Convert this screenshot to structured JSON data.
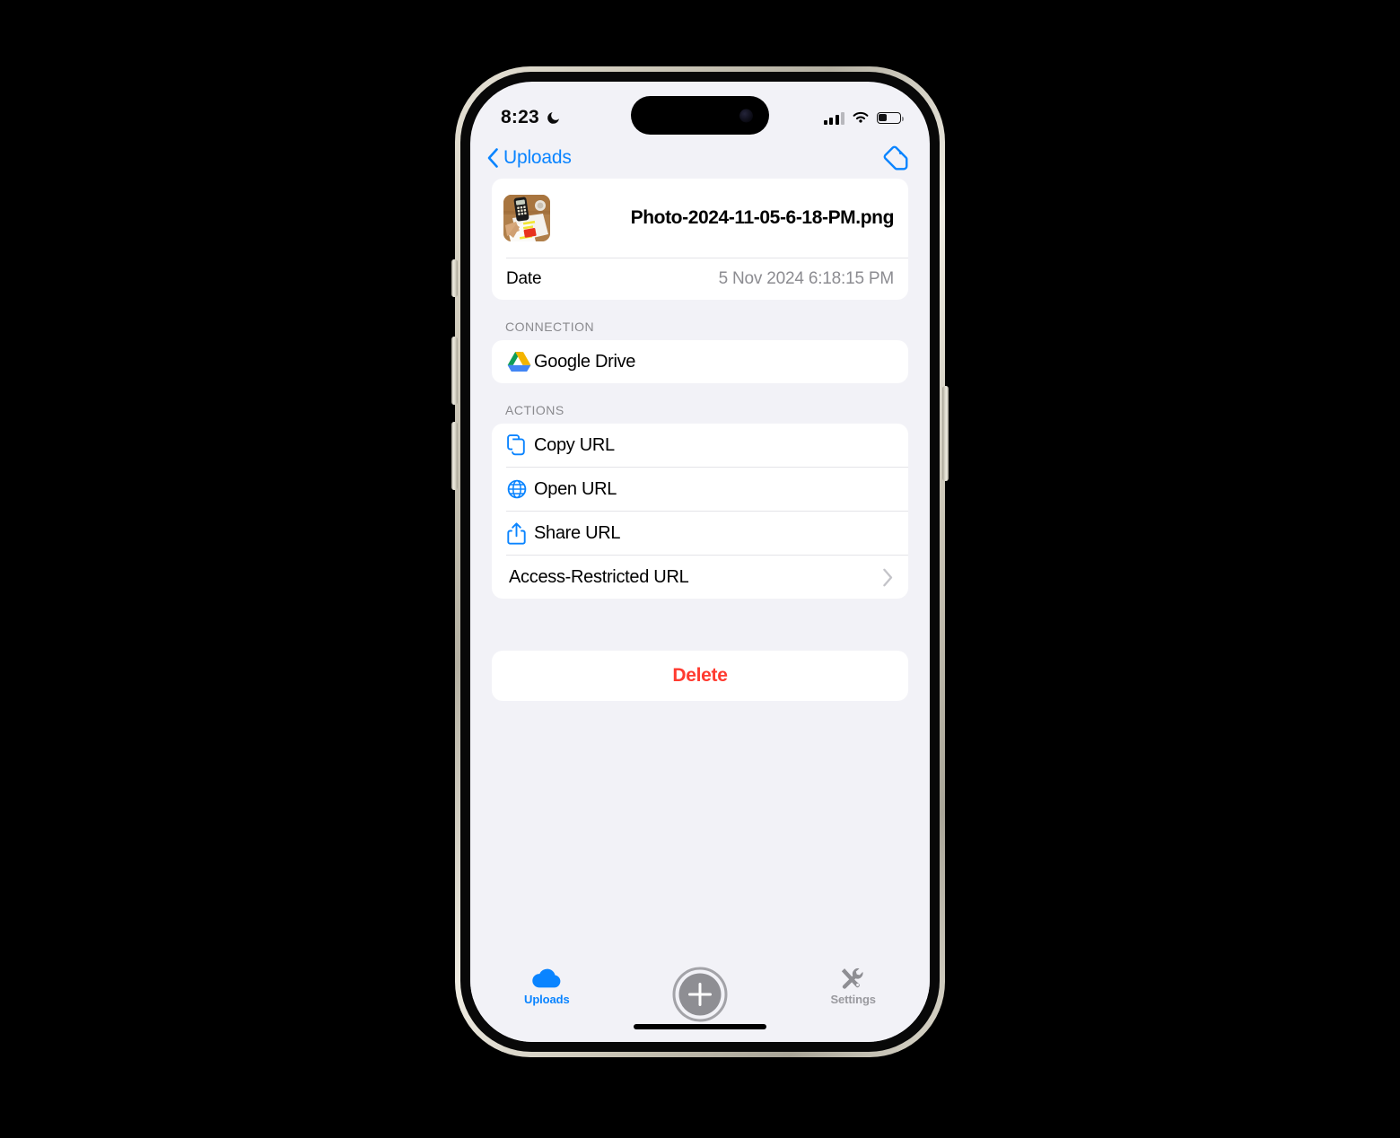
{
  "status_bar": {
    "time": "8:23",
    "dnd_icon": "moon-icon",
    "signal_icon": "cellular-signal-icon",
    "signal_bars_filled": 3,
    "signal_bars_total": 4,
    "wifi_icon": "wifi-icon",
    "battery_icon": "battery-icon",
    "battery_percent": 38
  },
  "nav": {
    "back_label": "Uploads",
    "back_icon": "chevron-left-icon",
    "tag_icon": "tag-icon"
  },
  "file": {
    "thumbnail_alt": "calculator-and-documents-photo",
    "name": "Photo-2024-11-05-6-18-PM.png",
    "date_key": "Date",
    "date_value": "5 Nov 2024 6:18:15 PM"
  },
  "connection": {
    "header": "CONNECTION",
    "name": "Google Drive",
    "icon": "google-drive-icon"
  },
  "actions": {
    "header": "ACTIONS",
    "items": [
      {
        "label": "Copy URL",
        "icon": "copy-doc-icon"
      },
      {
        "label": "Open URL",
        "icon": "globe-icon"
      },
      {
        "label": "Share URL",
        "icon": "share-icon"
      },
      {
        "label": "Access-Restricted URL",
        "icon": "chevron-right-icon"
      }
    ]
  },
  "delete": {
    "label": "Delete"
  },
  "tabbar": {
    "uploads": {
      "label": "Uploads",
      "icon": "cloud-icon"
    },
    "add": {
      "label": "",
      "icon": "plus-circle-icon"
    },
    "settings": {
      "label": "Settings",
      "icon": "tools-icon"
    }
  },
  "colors": {
    "accent": "#0a84ff",
    "destructive": "#ff3b30",
    "background": "#f2f2f7",
    "card": "#ffffff",
    "secondary_text": "#8a8a8e"
  }
}
